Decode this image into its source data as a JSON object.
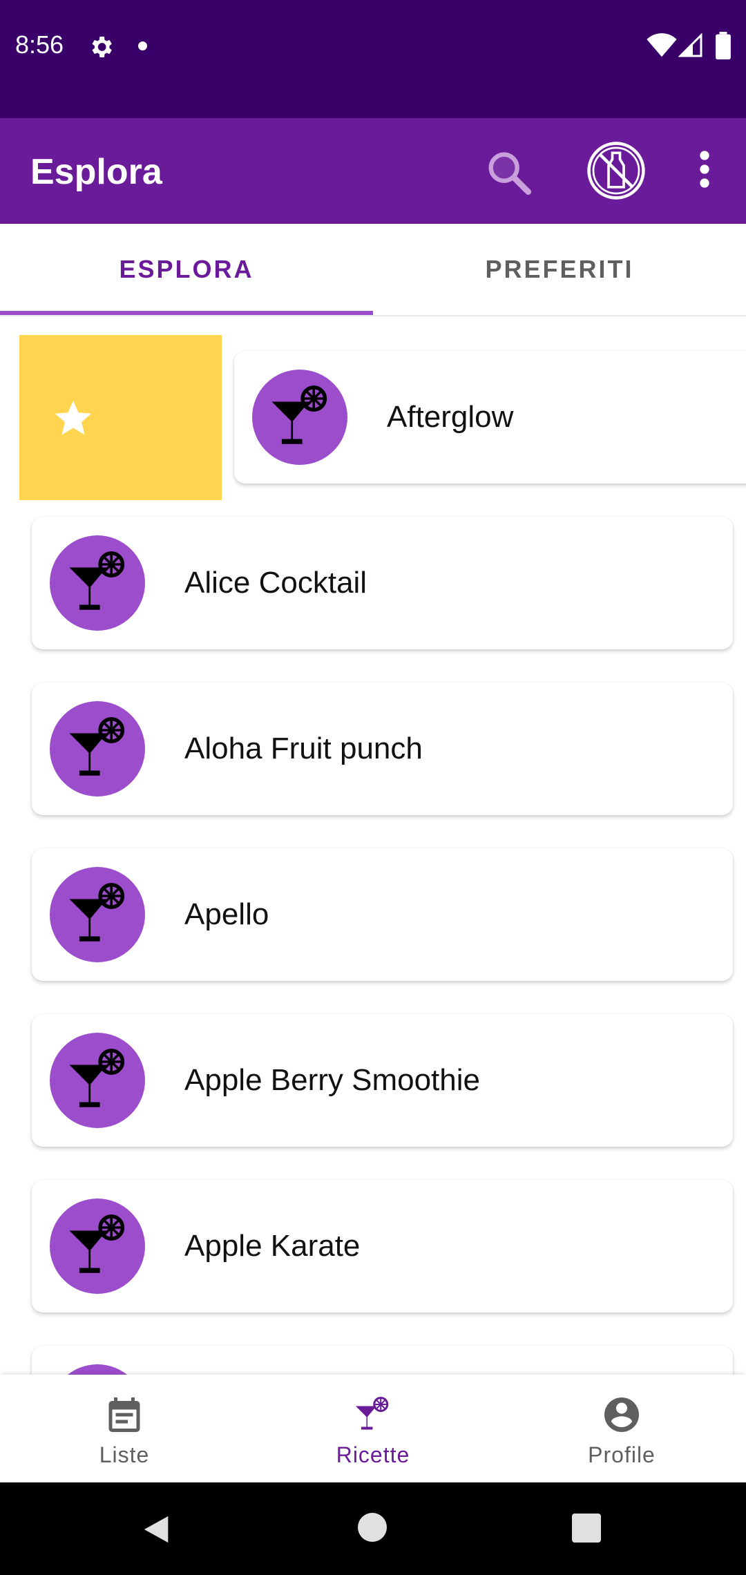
{
  "status_bar": {
    "time": "8:56",
    "icons": [
      "gear-icon",
      "dot-icon",
      "wifi-icon",
      "signal-icon",
      "battery-icon"
    ]
  },
  "app_bar": {
    "title": "Esplora",
    "actions": [
      "search-icon",
      "no-alcohol-icon",
      "more-vert-icon"
    ]
  },
  "tabs": [
    {
      "label": "ESPLORA",
      "active": true
    },
    {
      "label": "PREFERITI",
      "active": false
    }
  ],
  "swipe_action": {
    "icon": "star-icon",
    "color": "#ffd54f"
  },
  "list": {
    "items": [
      {
        "name": "Afterglow",
        "icon": "cocktail-icon"
      },
      {
        "name": "Alice Cocktail",
        "icon": "cocktail-icon"
      },
      {
        "name": "Aloha Fruit punch",
        "icon": "cocktail-icon"
      },
      {
        "name": "Apello",
        "icon": "cocktail-icon"
      },
      {
        "name": "Apple Berry Smoothie",
        "icon": "cocktail-icon"
      },
      {
        "name": "Apple Karate",
        "icon": "cocktail-icon"
      },
      {
        "name": "",
        "icon": "cocktail-icon"
      }
    ]
  },
  "bottom_nav": [
    {
      "label": "Liste",
      "icon": "calendar-list-icon",
      "active": false
    },
    {
      "label": "Ricette",
      "icon": "cocktail-icon",
      "active": true
    },
    {
      "label": "Profile",
      "icon": "account-circle-icon",
      "active": false
    }
  ],
  "colors": {
    "status_bar": "#3a006a",
    "app_bar": "#6a1b9a",
    "accent": "#9c4dcc",
    "swipe": "#ffd54f",
    "inactive": "#5f5f5f"
  }
}
